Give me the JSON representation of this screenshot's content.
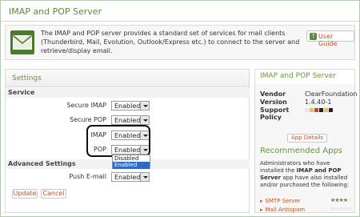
{
  "title": "IMAP and POP Server",
  "intro": {
    "description": "The IMAP and POP server provides a standard set of services for mail clients (Thunderbird, Mail, Evolution, Outlook/Express etc.) to connect to the server and retrieve/display email.",
    "user_guide_label": "User Guide"
  },
  "settings": {
    "header": "Settings",
    "service_section": "Service",
    "advanced_section": "Advanced Settings",
    "rows": [
      {
        "label": "Secure IMAP",
        "value": "Enabled"
      },
      {
        "label": "Secure POP",
        "value": "Enabled"
      },
      {
        "label": "IMAP",
        "value": "Enabled"
      },
      {
        "label": "POP",
        "value": "Enabled"
      },
      {
        "label": "Push E-mail",
        "value": "Enabled"
      }
    ],
    "dropdown_options": [
      "Disabled",
      "Enabled"
    ],
    "update_label": "Update",
    "cancel_label": "Cancel"
  },
  "sidebar": {
    "header": "IMAP and POP Server",
    "vendor_label": "Vendor",
    "vendor_value": "ClearFoundation",
    "version_label": "Version",
    "version_value": "1.4.40-1",
    "support_label": "Support",
    "policy_label": "Policy",
    "app_details_label": "App Details",
    "recommended_title": "Recommended Apps",
    "recommended_text_1": "Administrators who have installed the ",
    "recommended_app_bold": "IMAP and POP Server",
    "recommended_text_2": " app have also installed and/or purchased the following:",
    "recommended_apps": [
      {
        "name": "SMTP Server",
        "rating": 4
      },
      {
        "name": "Mail Antispam",
        "rating": 0
      }
    ]
  },
  "colors": {
    "accent_green": "#5f8a3c",
    "link_orange": "#c4521f",
    "selection_blue": "#316ac5"
  }
}
